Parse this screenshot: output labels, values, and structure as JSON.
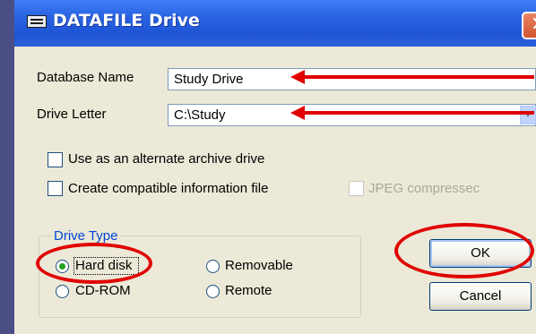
{
  "window": {
    "title": "DATAFILE Drive",
    "close_glyph": "✕"
  },
  "form": {
    "database_name_label": "Database Name",
    "database_name_value": "Study Drive",
    "drive_letter_label": "Drive Letter",
    "drive_letter_value": "C:\\Study",
    "dropdown_glyph": "▾"
  },
  "options": {
    "alternate_archive_label": "Use as an alternate archive drive",
    "alternate_archive_checked": false,
    "compatible_info_label": "Create compatible information file",
    "compatible_info_checked": false,
    "jpeg_label": "JPEG compressec",
    "jpeg_enabled": false
  },
  "drive_type": {
    "title": "Drive Type",
    "selected": "Hard disk",
    "options": [
      "Hard disk",
      "Removable",
      "CD-ROM",
      "Remote"
    ]
  },
  "buttons": {
    "ok_label": "OK",
    "cancel_label": "Cancel"
  },
  "annotation_color": "#e00000",
  "icons": [
    "window-icon",
    "close-icon",
    "dropdown-arrow-icon",
    "annotation-arrow-icon",
    "annotation-circle"
  ]
}
